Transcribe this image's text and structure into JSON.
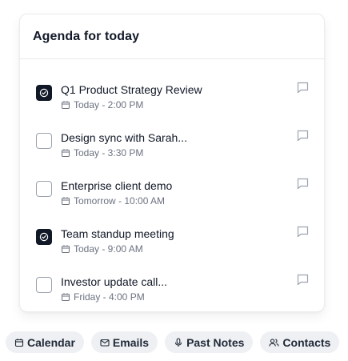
{
  "card": {
    "title": "Agenda for today"
  },
  "items": [
    {
      "title": "Q1 Product Strategy Review",
      "meta": "Today - 2:00 PM",
      "checked": true
    },
    {
      "title": "Design sync with Sarah...",
      "meta": "Today - 3:30 PM",
      "checked": false
    },
    {
      "title": "Enterprise client demo",
      "meta": "Tomorrow - 10:00 AM",
      "checked": false
    },
    {
      "title": "Team standup meeting",
      "meta": "Today - 9:00 AM",
      "checked": true
    },
    {
      "title": "Investor update call...",
      "meta": "Friday - 4:00 PM",
      "checked": false
    }
  ],
  "chips": [
    {
      "label": "Calendar",
      "icon": "calendar-icon"
    },
    {
      "label": "Emails",
      "icon": "mail-icon"
    },
    {
      "label": "Past Notes",
      "icon": "microphone-icon"
    },
    {
      "label": "Contacts",
      "icon": "users-icon"
    }
  ],
  "colors": {
    "checked_bg": "#111827",
    "chip_bg": "#eef0f3",
    "meta_text": "#6b7280"
  }
}
